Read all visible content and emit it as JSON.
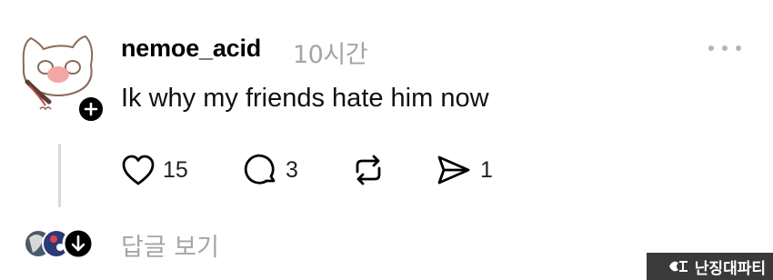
{
  "post": {
    "username": "nemoe_acid",
    "time": "10시간",
    "text": "Ik why my friends hate him now"
  },
  "actions": {
    "likes": "15",
    "replies": "3",
    "shares": "1"
  },
  "replies_link": "답글 보기",
  "watermark": "난징대파티",
  "icons": {
    "follow": "plus-icon",
    "more": "more-horizontal-icon",
    "like": "heart-icon",
    "reply": "comment-icon",
    "repost": "repost-icon",
    "share": "send-icon",
    "reply_avatar_badge": "arrow-down-icon"
  },
  "colors": {
    "text": "#000000",
    "muted": "#a5a5a5",
    "thread_line": "#d9d9d9"
  }
}
